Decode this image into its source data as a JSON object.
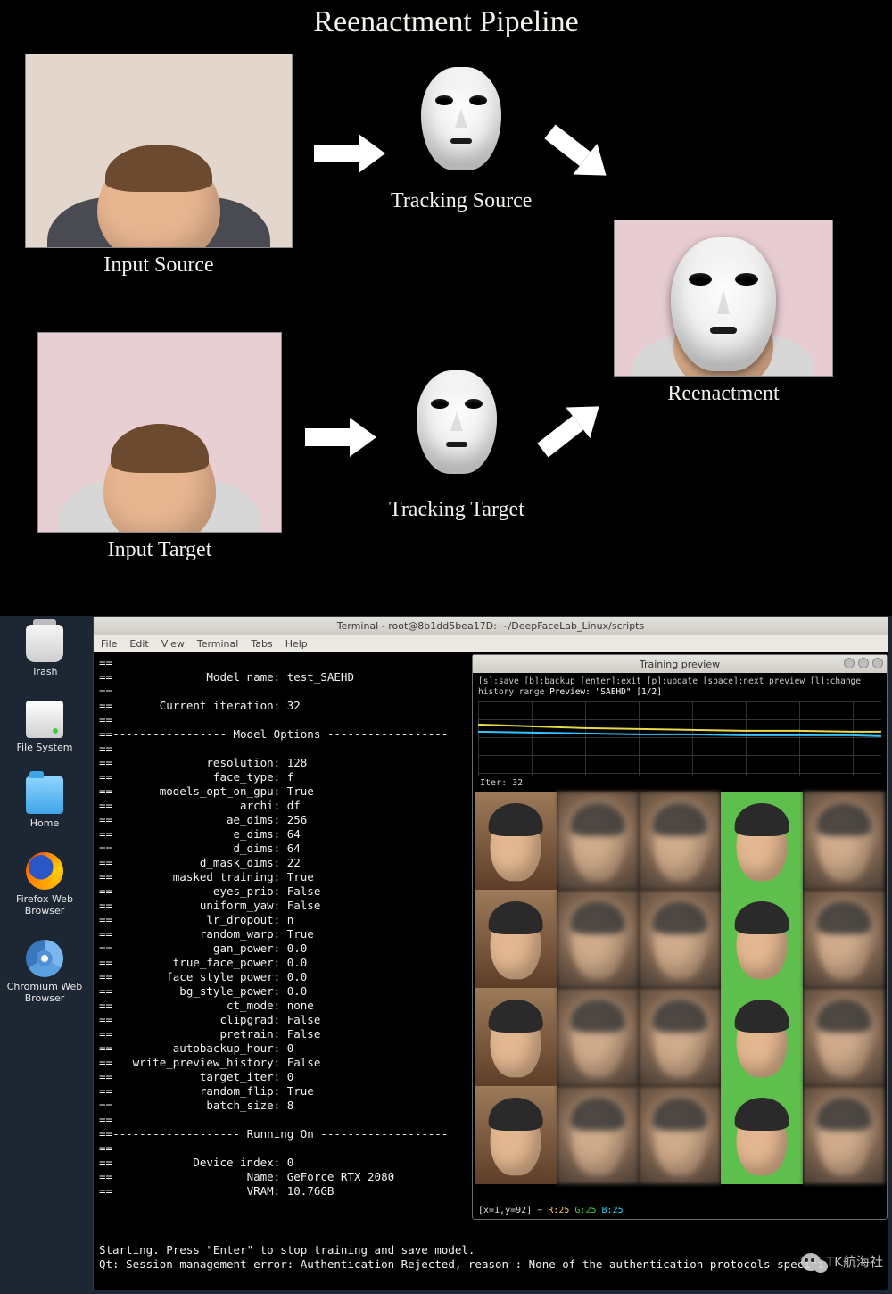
{
  "pipeline": {
    "title": "Reenactment Pipeline",
    "input_source_caption": "Input Source",
    "input_target_caption": "Input Target",
    "tracking_source_caption": "Tracking Source",
    "tracking_target_caption": "Tracking Target",
    "reenactment_caption": "Reenactment"
  },
  "desktop_icons": {
    "trash": "Trash",
    "filesystem": "File System",
    "home": "Home",
    "firefox": "Firefox Web Browser",
    "chromium": "Chromium Web Browser"
  },
  "terminal": {
    "title": "Terminal - root@8b1dd5bea17D: ~/DeepFaceLab_Linux/scripts",
    "menus": [
      "File",
      "Edit",
      "View",
      "Terminal",
      "Tabs",
      "Help"
    ],
    "header": {
      "model_name": "test_SAEHD",
      "current_iteration": "32"
    },
    "model_options_label": "Model Options",
    "options": [
      {
        "k": "resolution",
        "v": "128"
      },
      {
        "k": "face_type",
        "v": "f"
      },
      {
        "k": "models_opt_on_gpu",
        "v": "True"
      },
      {
        "k": "archi",
        "v": "df"
      },
      {
        "k": "ae_dims",
        "v": "256"
      },
      {
        "k": "e_dims",
        "v": "64"
      },
      {
        "k": "d_dims",
        "v": "64"
      },
      {
        "k": "d_mask_dims",
        "v": "22"
      },
      {
        "k": "masked_training",
        "v": "True"
      },
      {
        "k": "eyes_prio",
        "v": "False"
      },
      {
        "k": "uniform_yaw",
        "v": "False"
      },
      {
        "k": "lr_dropout",
        "v": "n"
      },
      {
        "k": "random_warp",
        "v": "True"
      },
      {
        "k": "gan_power",
        "v": "0.0"
      },
      {
        "k": "true_face_power",
        "v": "0.0"
      },
      {
        "k": "face_style_power",
        "v": "0.0"
      },
      {
        "k": "bg_style_power",
        "v": "0.0"
      },
      {
        "k": "ct_mode",
        "v": "none"
      },
      {
        "k": "clipgrad",
        "v": "False"
      },
      {
        "k": "pretrain",
        "v": "False"
      },
      {
        "k": "autobackup_hour",
        "v": "0"
      },
      {
        "k": "write_preview_history",
        "v": "False"
      },
      {
        "k": "target_iter",
        "v": "0"
      },
      {
        "k": "random_flip",
        "v": "True"
      },
      {
        "k": "batch_size",
        "v": "8"
      }
    ],
    "running_on_label": "Running On",
    "device": {
      "device_index": "0",
      "name": "GeForce RTX 2080",
      "vram": "10.76GB"
    },
    "footer1": "Starting. Press \"Enter\" to stop training and save model.",
    "footer2": "Qt: Session management error: Authentication Rejected, reason : None of the authentication protocols specifi"
  },
  "preview": {
    "title": "Training preview",
    "hint1": "[s]:save [b]:backup [enter]:exit",
    "hint2": "[p]:update [space]:next preview [l]:change history range",
    "hint3": "Preview: \"SAEHD\" [1/2]",
    "iter_label": "Iter: 32",
    "status_prefix": "[x=1,y=92] ~ ",
    "status_r": "R:25",
    "status_g": "G:25",
    "status_b": "B:25"
  },
  "overlay": {
    "wechat_text": "TK航海社"
  }
}
